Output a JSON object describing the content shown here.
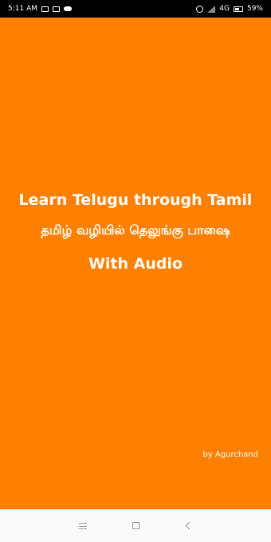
{
  "status_bar": {
    "time": "5:11 AM",
    "network": "4G",
    "battery": "59%",
    "left_icons": [
      "message-icon",
      "mail-icon",
      "cloud-icon"
    ],
    "right_icons": [
      "alarm-icon",
      "signal-icon",
      "battery-icon"
    ]
  },
  "splash": {
    "background_color": "#ff8000",
    "title_en": "Learn Telugu through Tamil",
    "title_ta": "தமிழ் வழியில் தெலுங்கு பாஷை",
    "subtitle": "With Audio",
    "author": "by Agurchand"
  },
  "nav_bar": {
    "buttons": [
      "menu-icon",
      "home-icon",
      "back-icon"
    ]
  }
}
